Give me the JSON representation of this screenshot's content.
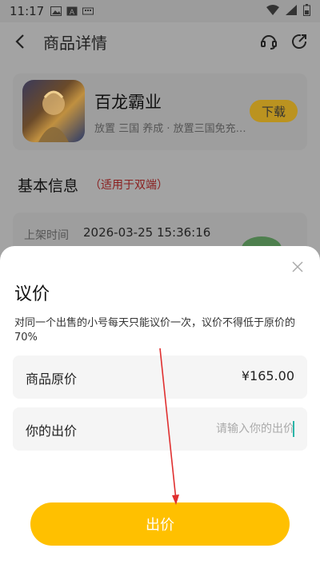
{
  "status_bar": {
    "time": "11:17"
  },
  "header": {
    "title": "商品详情"
  },
  "game": {
    "name": "百龙霸业",
    "tags": "放置 三国 养成 · 放置三国免充…",
    "download_label": "下载"
  },
  "basic_info": {
    "title": "基本信息",
    "note": "（适用于双端）",
    "list_time_label": "上架时间",
    "list_time_value": "2026-03-25 15:36:16"
  },
  "sheet": {
    "title": "议价",
    "description": "对同一个出售的小号每天只能议价一次，议价不得低于原价的70%",
    "original_price_label": "商品原价",
    "original_price_value": "¥165.00",
    "your_bid_label": "你的出价",
    "your_bid_placeholder": "请输入你的出价",
    "your_bid_value": "",
    "submit_label": "出价"
  },
  "colors": {
    "accent": "#FFC000",
    "annotation_arrow": "#E03030",
    "note_red": "#C0392B"
  }
}
